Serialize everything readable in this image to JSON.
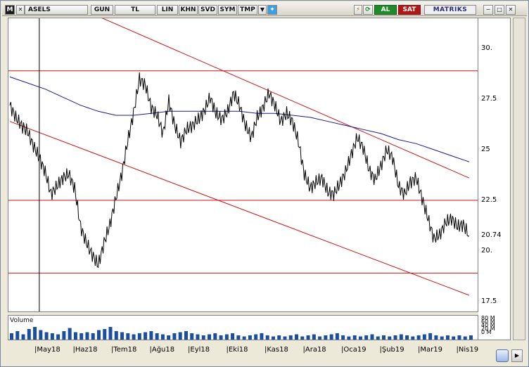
{
  "toolbar": {
    "menu_label": "M",
    "symbol": "ASELS",
    "period": "GUN",
    "currency": "TL",
    "scale": "LIN",
    "buttons": [
      "KHN",
      "SVD",
      "SYM",
      "TMP"
    ],
    "buy_label": "AL",
    "sell_label": "SAT",
    "brand": "MATRIKS",
    "icons": [
      "chart-type-icon",
      "lightning-icon",
      "refresh-icon",
      "twitter-icon",
      "minimize-icon",
      "maximize-icon",
      "close-icon"
    ]
  },
  "colors": {
    "price_line": "#000000",
    "moving_average": "#1a1a8c",
    "channel": "#c81414",
    "volume": "#1a4fa0"
  },
  "volume_label": "Volume",
  "volume_ticks": [
    "80 M",
    "60 M",
    "40 M",
    "20 M",
    "0 M"
  ],
  "chart_data": {
    "type": "line",
    "title": "",
    "symbol": "ASELS",
    "xlabel": "",
    "ylabel": "",
    "ylim": [
      17.0,
      31.5
    ],
    "y_ticks": [
      17.5,
      20,
      22.5,
      25,
      27.5,
      30
    ],
    "y_tick_labels": [
      "17.5",
      "20.",
      "22.5",
      "25",
      "27.5",
      "30."
    ],
    "last_price": 20.74,
    "last_price_label": "20.74",
    "x_labels": [
      "May18",
      "Haz18",
      "Tem18",
      "Ağu18",
      "Eyl18",
      "Eki18",
      "Kas18",
      "Ara18",
      "Oca19",
      "Şub19",
      "Mar19",
      "Nis19"
    ],
    "price": [
      27.2,
      26.6,
      26.2,
      25.9,
      25.2,
      24.6,
      23.9,
      22.8,
      23.2,
      23.6,
      23.8,
      23.1,
      21.2,
      20.4,
      19.8,
      19.3,
      20.4,
      21.3,
      22.6,
      23.8,
      25.4,
      26.8,
      28.5,
      28.2,
      27.1,
      26.7,
      25.8,
      27.4,
      26.2,
      25.4,
      26.0,
      26.2,
      26.5,
      26.9,
      27.6,
      26.8,
      26.5,
      26.9,
      27.8,
      27.2,
      26.2,
      25.6,
      26.6,
      27.1,
      27.8,
      27.2,
      26.4,
      26.8,
      26.4,
      25.4,
      23.8,
      23.1,
      23.4,
      23.6,
      22.9,
      22.8,
      23.3,
      23.9,
      24.8,
      25.6,
      25.1,
      24.0,
      23.5,
      24.2,
      25.0,
      24.6,
      23.2,
      22.8,
      23.4,
      23.6,
      22.6,
      21.6,
      20.6,
      20.8,
      21.4,
      21.6,
      21.2,
      21.3,
      20.74
    ],
    "moving_average": [
      28.6,
      28.3,
      28.0,
      27.6,
      27.2,
      26.9,
      26.7,
      26.7,
      26.8,
      26.9,
      26.9,
      26.9,
      26.9,
      26.9,
      26.8,
      26.8,
      26.7,
      26.6,
      26.4,
      26.2,
      26.0,
      25.8,
      25.5,
      25.3,
      25.0,
      24.7,
      24.4
    ],
    "moving_average_start_index": 0,
    "moving_average_end_index": 78,
    "volume": [
      30,
      40,
      25,
      50,
      60,
      45,
      35,
      30,
      25,
      40,
      55,
      35,
      30,
      35,
      30,
      45,
      50,
      60,
      40,
      35,
      30,
      25,
      30,
      35,
      40,
      30,
      25,
      20,
      30,
      35,
      40,
      30,
      25,
      20,
      25,
      30,
      20,
      25,
      30,
      20,
      15,
      20,
      25,
      30,
      20,
      15,
      20,
      15,
      20,
      25,
      15,
      20,
      25,
      15,
      20,
      25,
      30,
      20,
      15,
      20,
      15,
      20,
      25,
      15,
      20,
      15,
      20,
      25,
      20,
      15,
      20,
      25,
      30,
      20,
      15,
      20,
      15,
      20,
      15,
      20
    ],
    "horizontal_lines": [
      28.9,
      22.5,
      18.9
    ],
    "trendlines": [
      {
        "start": [
          0,
          33.5
        ],
        "end": [
          78,
          23.6
        ]
      },
      {
        "start": [
          0,
          26.4
        ],
        "end": [
          78,
          17.8
        ]
      }
    ],
    "cursor_index": 5
  }
}
